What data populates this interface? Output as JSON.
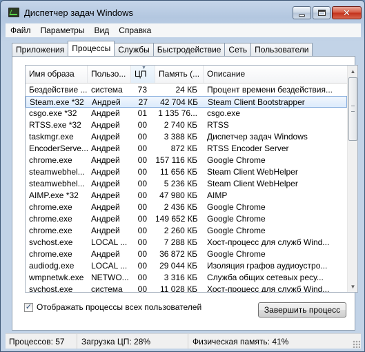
{
  "window": {
    "title": "Диспетчер задач Windows"
  },
  "menu": [
    "Файл",
    "Параметры",
    "Вид",
    "Справка"
  ],
  "tabs": [
    {
      "label": "Приложения",
      "active": false
    },
    {
      "label": "Процессы",
      "active": true
    },
    {
      "label": "Службы",
      "active": false
    },
    {
      "label": "Быстродействие",
      "active": false
    },
    {
      "label": "Сеть",
      "active": false
    },
    {
      "label": "Пользователи",
      "active": false
    }
  ],
  "table": {
    "columns": [
      "Имя образа",
      "Пользо...",
      "ЦП",
      "Память (...",
      "Описание"
    ],
    "sorted_column": "ЦП",
    "selected_row_index": 1,
    "rows": [
      [
        "Бездействие ...",
        "система",
        "73",
        "24 КБ",
        "Процент времени бездействия..."
      ],
      [
        "Steam.exe *32",
        "Андрей",
        "27",
        "42 704 КБ",
        "Steam Client Bootstrapper"
      ],
      [
        "csgo.exe *32",
        "Андрей",
        "01",
        "1 135 76...",
        "csgo.exe"
      ],
      [
        "RTSS.exe *32",
        "Андрей",
        "00",
        "2 740 КБ",
        "RTSS"
      ],
      [
        "taskmgr.exe",
        "Андрей",
        "00",
        "3 388 КБ",
        "Диспетчер задач Windows"
      ],
      [
        "EncoderServe...",
        "Андрей",
        "00",
        "872 КБ",
        "RTSS Encoder Server"
      ],
      [
        "chrome.exe",
        "Андрей",
        "00",
        "157 116 КБ",
        "Google Chrome"
      ],
      [
        "steamwebhel...",
        "Андрей",
        "00",
        "11 656 КБ",
        "Steam Client WebHelper"
      ],
      [
        "steamwebhel...",
        "Андрей",
        "00",
        "5 236 КБ",
        "Steam Client WebHelper"
      ],
      [
        "AIMP.exe *32",
        "Андрей",
        "00",
        "47 980 КБ",
        "AIMP"
      ],
      [
        "chrome.exe",
        "Андрей",
        "00",
        "2 436 КБ",
        "Google Chrome"
      ],
      [
        "chrome.exe",
        "Андрей",
        "00",
        "149 652 КБ",
        "Google Chrome"
      ],
      [
        "chrome.exe",
        "Андрей",
        "00",
        "2 260 КБ",
        "Google Chrome"
      ],
      [
        "svchost.exe",
        "LOCAL ...",
        "00",
        "7 288 КБ",
        "Хост-процесс для служб Wind..."
      ],
      [
        "chrome.exe",
        "Андрей",
        "00",
        "36 872 КБ",
        "Google Chrome"
      ],
      [
        "audiodg.exe",
        "LOCAL ...",
        "00",
        "29 044 КБ",
        "Изоляция графов аудиоустро..."
      ],
      [
        "wmpnetwk.exe",
        "NETWO...",
        "00",
        "3 316 КБ",
        "Служба общих сетевых ресу..."
      ],
      [
        "svchost.exe",
        "система",
        "00",
        "11 028 КБ",
        "Хост-процесс для служб Wind..."
      ]
    ]
  },
  "show_all_users": {
    "label": "Отображать процессы всех пользователей",
    "checked": true
  },
  "end_process_button": "Завершить процесс",
  "status": {
    "processes": "Процессов: 57",
    "cpu": "Загрузка ЦП: 28%",
    "memory": "Физическая память: 41%"
  }
}
